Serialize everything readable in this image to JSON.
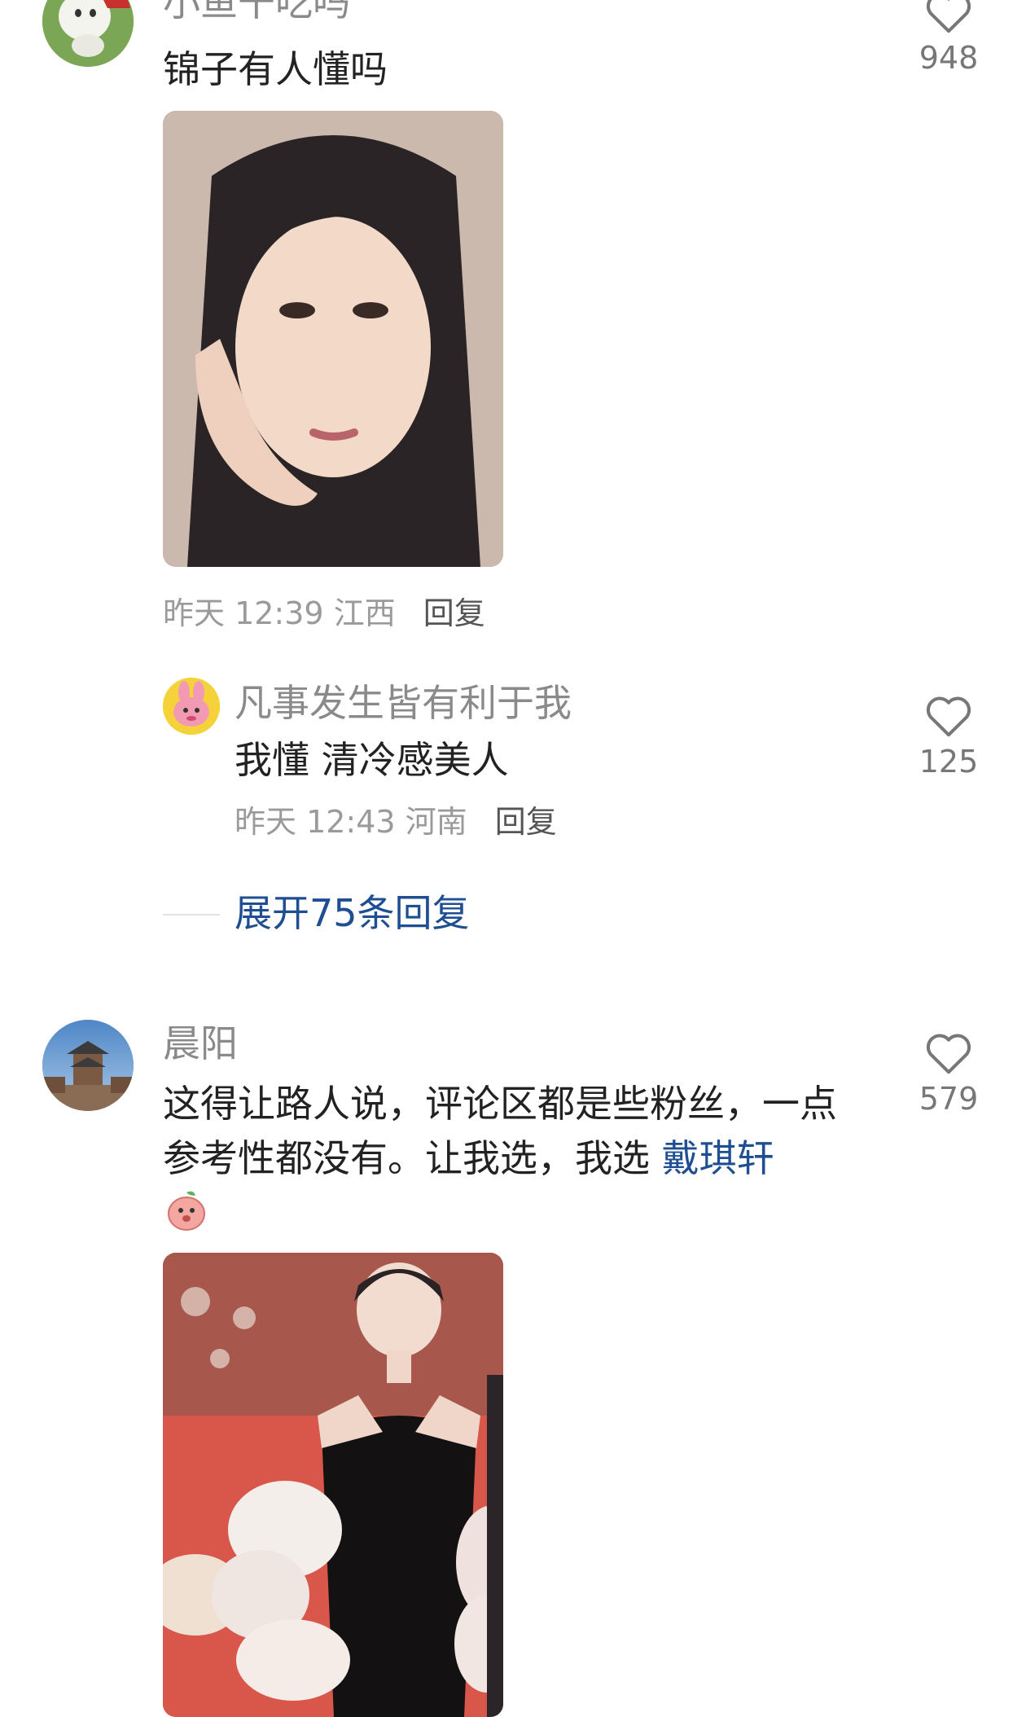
{
  "comments": [
    {
      "username": "小鱼干吃吗",
      "text": "锦子有人懂吗",
      "time": "昨天 12:39",
      "location": "江西",
      "reply_label": "回复",
      "likes": "948",
      "icons": {
        "avatar": "cartoon-dog-avatar",
        "like": "heart-outline-icon"
      },
      "replies": [
        {
          "username": "凡事发生皆有利于我",
          "text": "我懂 清冷感美人",
          "time": "昨天 12:43",
          "location": "河南",
          "reply_label": "回复",
          "likes": "125"
        }
      ],
      "expand_label": "展开75条回复"
    },
    {
      "username": "晨阳",
      "text_part1": "这得让路人说，评论区都是些粉丝，一点参考性都没有。让我选，我选 ",
      "mention": "戴琪轩",
      "likes": "579",
      "emoji": "peach-emoji-icon"
    }
  ],
  "colors": {
    "username": "#8a8a8a",
    "link": "#1f4f92",
    "meta": "#9a9a9a"
  }
}
